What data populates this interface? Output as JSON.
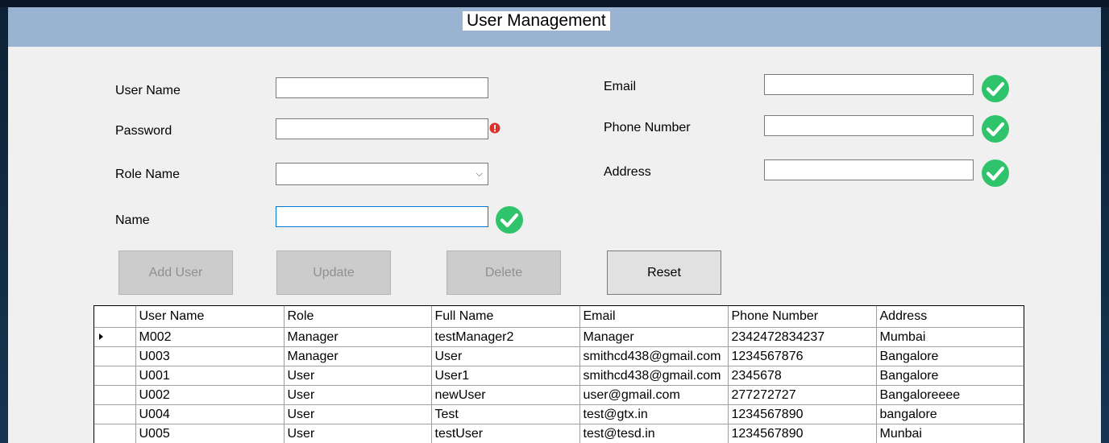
{
  "window": {
    "title": "User Management"
  },
  "form": {
    "username_label": "User Name",
    "password_label": "Password",
    "role_label": "Role Name",
    "name_label": "Name",
    "email_label": "Email",
    "phone_label": "Phone Number",
    "address_label": "Address",
    "username_value": "",
    "password_value": "",
    "role_value": "",
    "name_value": "",
    "email_value": "",
    "phone_value": "",
    "address_value": ""
  },
  "validation": {
    "password": "error",
    "name": "ok",
    "email": "ok",
    "phone": "ok",
    "address": "ok",
    "ok_color": "#2fc46b",
    "error_color": "#e0302a"
  },
  "buttons": {
    "add": "Add User",
    "update": "Update",
    "delete": "Delete",
    "reset": "Reset"
  },
  "grid": {
    "columns": [
      "User Name",
      "Role",
      "Full Name",
      "Email",
      "Phone Number",
      "Address"
    ],
    "rows": [
      [
        "M002",
        "Manager",
        "testManager2",
        "Manager",
        "2342472834237",
        "Mumbai"
      ],
      [
        "U003",
        "Manager",
        "User",
        "smithcd438@gmail.com",
        "1234567876",
        "Bangalore"
      ],
      [
        "U001",
        "User",
        "User1",
        "smithcd438@gmail.com",
        "2345678",
        "Bangalore"
      ],
      [
        "U002",
        "User",
        "newUser",
        "user@gmail.com",
        "277272727",
        "Bangaloreeee"
      ],
      [
        "U004",
        "User",
        "Test",
        "test@gtx.in",
        "1234567890",
        "bangalore"
      ],
      [
        "U005",
        "User",
        "testUser",
        "test@tesd.in",
        "1234567890",
        "Munbai"
      ]
    ],
    "current_row": 0
  },
  "colors": {
    "header_bar": "#9ab3d3",
    "form_bg": "#f0f0f0",
    "focus_border": "#0078d7"
  }
}
